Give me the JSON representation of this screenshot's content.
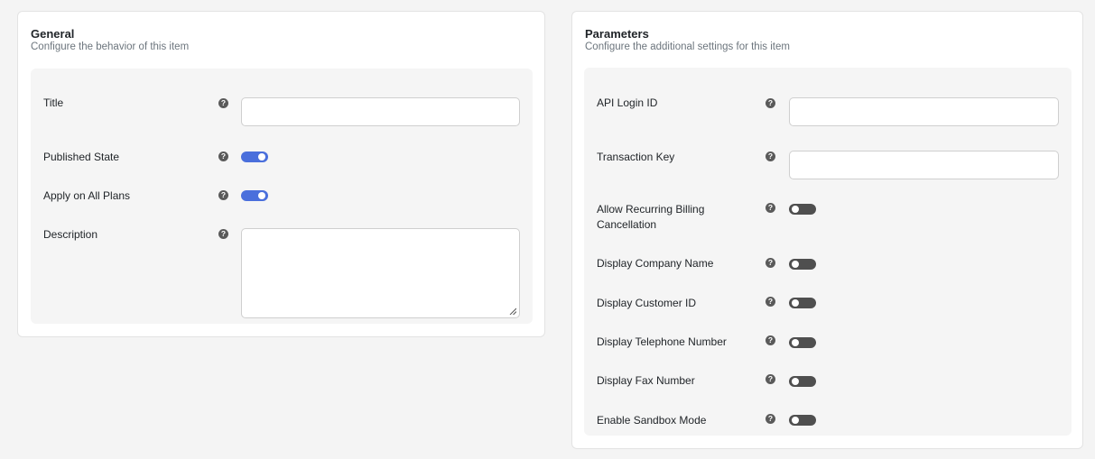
{
  "general": {
    "title": "General",
    "subtitle": "Configure the behavior of this item",
    "fields": {
      "title_label": "Title",
      "published_label": "Published State",
      "apply_label": "Apply on All Plans",
      "description_label": "Description"
    },
    "values": {
      "title": "",
      "description": "",
      "published": true,
      "apply_all_plans": true
    }
  },
  "parameters": {
    "title": "Parameters",
    "subtitle": "Configure the additional settings for this item",
    "fields": {
      "api_login_label": "API Login ID",
      "transaction_key_label": "Transaction Key",
      "allow_recurring_label_line1": "Allow Recurring Billing",
      "allow_recurring_label_line2": "Cancellation",
      "company_name_label": "Display Company Name",
      "customer_id_label": "Display Customer ID",
      "telephone_label": "Display Telephone Number",
      "fax_label": "Display Fax Number",
      "sandbox_label": "Enable Sandbox Mode"
    },
    "values": {
      "api_login_id": "",
      "transaction_key": "",
      "allow_recurring_cancellation": false,
      "display_company_name": false,
      "display_customer_id": false,
      "display_telephone": false,
      "display_fax": false,
      "sandbox_mode": false
    }
  },
  "help_icon_glyph": "?",
  "colors": {
    "toggle_on": "#4a6fdc",
    "toggle_off": "#4f4f4f"
  }
}
